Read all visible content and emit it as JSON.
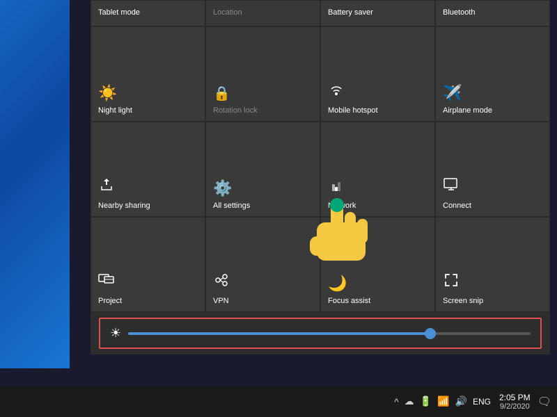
{
  "desktop": {
    "background": "linear-gradient(135deg, #1565c0 0%, #0d47a1 40%, #1976d2 100%)"
  },
  "header_row": [
    {
      "id": "tablet-mode",
      "label": "Tablet mode",
      "active": true,
      "disabled": false
    },
    {
      "id": "location",
      "label": "Location",
      "active": false,
      "disabled": true
    },
    {
      "id": "battery-saver",
      "label": "Battery saver",
      "active": false,
      "disabled": false
    },
    {
      "id": "bluetooth",
      "label": "Bluetooth",
      "active": false,
      "disabled": false
    }
  ],
  "tiles_row1": [
    {
      "id": "night-light",
      "label": "Night light",
      "icon": "☀",
      "active": false,
      "disabled": false
    },
    {
      "id": "rotation-lock",
      "label": "Rotation lock",
      "icon": "🔒",
      "active": false,
      "disabled": true
    },
    {
      "id": "mobile-hotspot",
      "label": "Mobile hotspot",
      "icon": "📶",
      "active": false,
      "disabled": false
    },
    {
      "id": "airplane-mode",
      "label": "Airplane mode",
      "icon": "✈",
      "active": false,
      "disabled": false
    }
  ],
  "tiles_row2": [
    {
      "id": "nearby-sharing",
      "label": "Nearby sharing",
      "icon": "⇑",
      "active": false,
      "disabled": false
    },
    {
      "id": "all-settings",
      "label": "All settings",
      "icon": "⚙",
      "active": false,
      "disabled": false
    },
    {
      "id": "network",
      "label": "Network",
      "icon": "📶",
      "active": false,
      "disabled": false
    },
    {
      "id": "connect",
      "label": "Connect",
      "icon": "📺",
      "active": false,
      "disabled": false
    }
  ],
  "tiles_row3": [
    {
      "id": "project",
      "label": "Project",
      "icon": "🖥",
      "active": false,
      "disabled": false
    },
    {
      "id": "vpn",
      "label": "VPN",
      "icon": "🔗",
      "active": false,
      "disabled": false
    },
    {
      "id": "focus-assist",
      "label": "Focus assist",
      "icon": "🌙",
      "active": false,
      "disabled": false
    },
    {
      "id": "screen-snip",
      "label": "Screen snip",
      "icon": "✂",
      "active": false,
      "disabled": false
    }
  ],
  "brightness": {
    "icon": "☀",
    "value": 75
  },
  "taskbar": {
    "chevron": "^",
    "time": "2:05 PM",
    "date": "9/2/2020",
    "lang": "ENG",
    "notification_icon": "🗨"
  }
}
